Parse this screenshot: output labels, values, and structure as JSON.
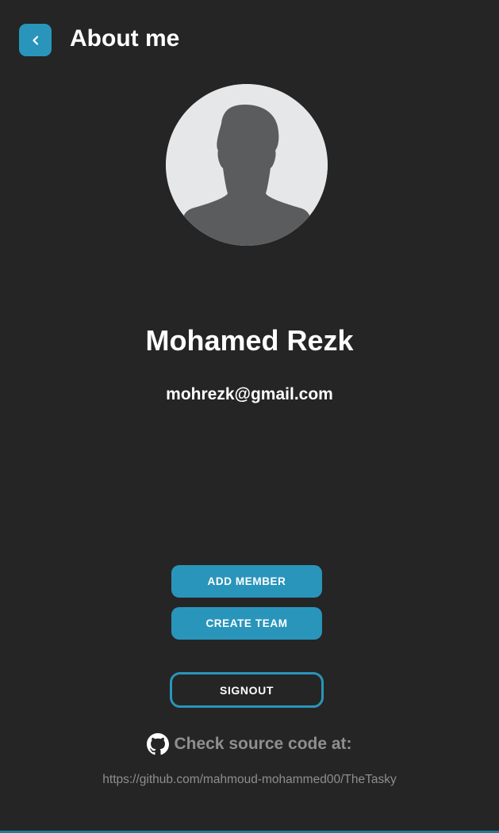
{
  "header": {
    "title": "About me",
    "back_icon": "chevron-left-icon"
  },
  "profile": {
    "name": "Mohamed Rezk",
    "email": "mohrezk@gmail.com",
    "avatar_icon": "default-user-avatar"
  },
  "actions": {
    "add_member_label": "ADD MEMBER",
    "create_team_label": "CREATE TEAM",
    "signout_label": "SIGNOUT"
  },
  "source": {
    "icon": "github-icon",
    "label": "Check source code at:",
    "url": "https://github.com/mahmoud-mohammed00/TheTasky"
  },
  "colors": {
    "background": "#252525",
    "accent": "#2a95bb",
    "muted_text": "#8f8f8f"
  }
}
